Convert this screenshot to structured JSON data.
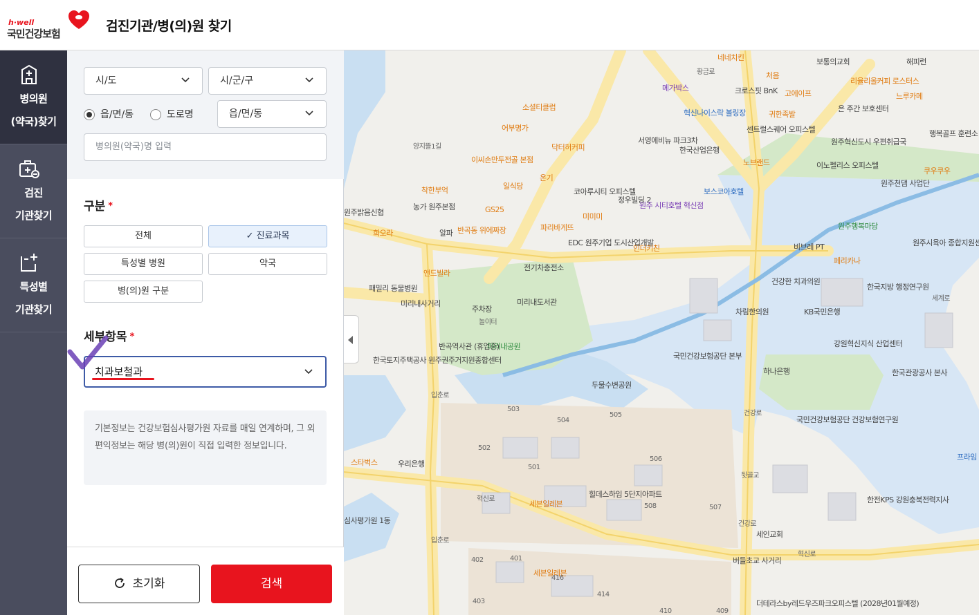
{
  "header": {
    "logo_small": "h·well",
    "logo_main": "국민건강보험",
    "title": "검진기관/병(의)원 찾기"
  },
  "nav": {
    "items": [
      {
        "line1": "병의원",
        "line2": "(약국)찾기",
        "icon": "hospital-icon",
        "active": true
      },
      {
        "line1": "검진",
        "line2": "기관찾기",
        "icon": "medical-bag-icon",
        "active": false
      },
      {
        "line1": "특성별",
        "line2": "기관찾기",
        "icon": "clipboard-plus-icon",
        "active": false
      }
    ]
  },
  "search": {
    "sido": "시/도",
    "sigungu": "시/군/구",
    "radio_emd": "읍/면/동",
    "radio_road": "도로명",
    "emd_select": "읍/면/동",
    "name_placeholder": "병의원(약국)명 입력"
  },
  "category": {
    "label": "구분",
    "required_mark": "*",
    "chips": [
      "전체",
      "✓ 진료과목",
      "특성별 병원",
      "약국",
      "병(의)원 구분"
    ]
  },
  "detail": {
    "label": "세부항목",
    "required_mark": "*",
    "value": "치과보철과"
  },
  "info_text": "기본정보는 건강보험심사평가원 자료를 매일 연계하며, 그 외 편익정보는 해당 병(의)원이 직접 입력한 정보입니다.",
  "buttons": {
    "reset": "초기화",
    "search": "검색"
  },
  "map": {
    "labels": [
      "네네치킨",
      "보통의교회",
      "해피런",
      "처음",
      "메가박스",
      "리율리올커피 로스터스",
      "크로스핏 BnK",
      "고에이프",
      "느루카메",
      "혁신나이스락 볼링장",
      "은 주간 보호센터",
      "귀한족발",
      "소셜티클럽",
      "어부명가",
      "센트럴스퀘어 오피스텔",
      "행복골프 훈련소",
      "서영에비뉴 파크3차",
      "원주혁신도시 우편취급국",
      "닥터허커피",
      "한국산업은행",
      "노브랜드",
      "이노펠리스 오피스텔",
      "이씨손만두전골 본점",
      "쿠우쿠우",
      "일식당",
      "온기",
      "코아루시티 오피스텔",
      "정우빌딩 2",
      "보스코아호텔",
      "원주천댐 사업단",
      "착한부억",
      "GS25",
      "농가 원주본점",
      "원주 시티호텔 혁신점",
      "원주밝음신협",
      "희오라",
      "반곡동 위에짜장",
      "알파",
      "파리바게뜨",
      "미미미",
      "원주행복마당",
      "원주시육아 종합지원센터",
      "EDC 원주기업 도시산업개발",
      "인더키친",
      "비브레 PT",
      "페리카나",
      "앤드빌라",
      "전기차충전소",
      "패밀리 동물병원",
      "미리내사거리",
      "주차장",
      "미리내도서관",
      "건강한 치과의원",
      "한국지방 행정연구원",
      "차림한의원",
      "KB국민은행",
      "놀이터",
      "반곡역사관 (휴업중)",
      "미리내공원",
      "국민건강보험공단 본부",
      "강원혁신지식 산업센터",
      "한국토지주택공사 원주권주거지원종합센터",
      "하나은행",
      "한국관광공사 본사",
      "두물수변공원",
      "국민건강보험공단 건강보험연구원",
      "스타벅스",
      "우리은행",
      "프라임 유치원",
      "힐데스하임 5단지아파트",
      "세븐일레븐",
      "심사평가원 1동",
      "한전KPS 강원충북전력지사",
      "세인교회",
      "버들초교 사거리",
      "세븐일레븐",
      "더테라스by레드우즈파크오피스텔 (2028년01월예정)",
      "혁신로",
      "입춘로",
      "건강로",
      "뒷골교",
      "세계로",
      "황금로",
      "양지뜰1길",
      "503",
      "504",
      "505",
      "502",
      "506",
      "501",
      "508",
      "507",
      "402",
      "401",
      "416",
      "414",
      "403",
      "410",
      "409"
    ]
  }
}
